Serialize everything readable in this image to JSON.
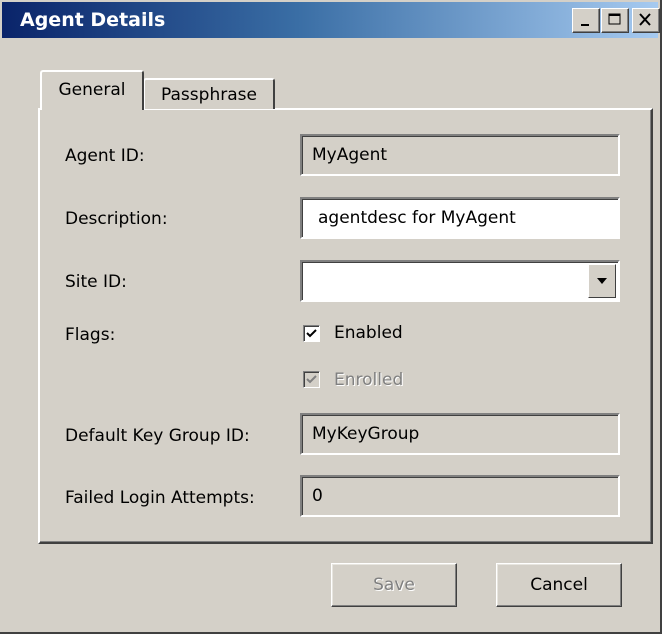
{
  "window": {
    "title": "Agent Details",
    "controls": {
      "minimize_icon": "minimize-icon",
      "maximize_icon": "maximize-icon",
      "close_icon": "close-icon"
    }
  },
  "tabs": [
    {
      "label": "General",
      "active": true
    },
    {
      "label": "Passphrase",
      "active": false
    }
  ],
  "form": {
    "agent_id": {
      "label": "Agent ID:",
      "value": "MyAgent",
      "readonly": true
    },
    "description": {
      "label": "Description:",
      "value": "agentdesc for MyAgent",
      "readonly": false
    },
    "site_id": {
      "label": "Site ID:",
      "value": "",
      "type": "dropdown"
    },
    "flags": {
      "label": "Flags:",
      "enabled": {
        "label": "Enabled",
        "checked": true,
        "disabled": false
      },
      "enrolled": {
        "label": "Enrolled",
        "checked": true,
        "disabled": true
      }
    },
    "default_key_group_id": {
      "label": "Default Key Group ID:",
      "value": "MyKeyGroup",
      "readonly": true
    },
    "failed_login_attempts": {
      "label": "Failed Login Attempts:",
      "value": "0",
      "readonly": true
    }
  },
  "buttons": {
    "save_label": "Save",
    "save_disabled": true,
    "cancel_label": "Cancel"
  },
  "colors": {
    "face": "#d4d0c8",
    "title_start": "#0a246a",
    "title_end": "#a6caf0",
    "disabled_text": "#808080"
  }
}
